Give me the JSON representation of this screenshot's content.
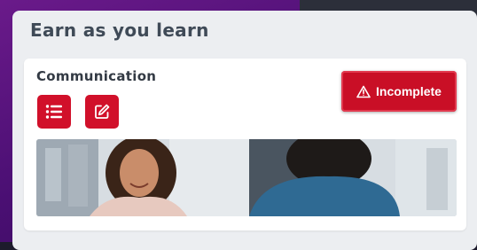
{
  "card": {
    "title": "Earn as you learn"
  },
  "module": {
    "title": "Communication",
    "status_label": "Incomplete",
    "status_icon": "warning-triangle-icon",
    "actions": [
      {
        "icon": "list-icon"
      },
      {
        "icon": "edit-icon"
      }
    ]
  },
  "colors": {
    "accent": "#d1102a",
    "card_bg": "#eceef1",
    "title_text": "#3f4a57"
  }
}
